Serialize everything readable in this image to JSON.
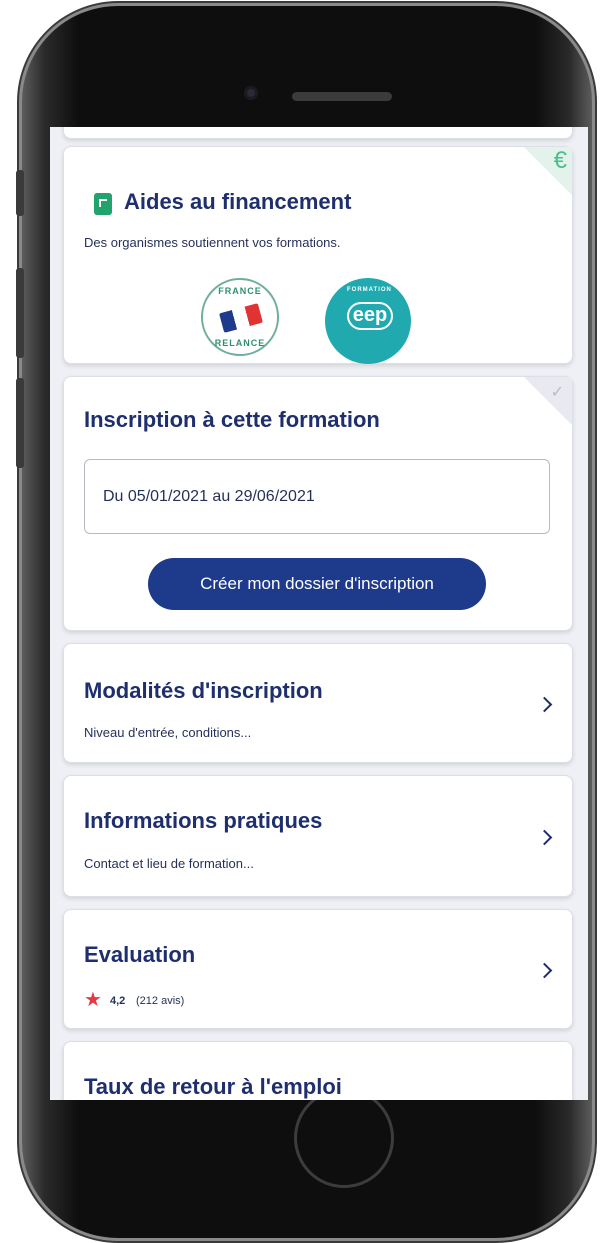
{
  "financing": {
    "title": "Aides au financement",
    "subtitle": "Des organismes soutiennent vos formations.",
    "logos": [
      {
        "name": "france-relance-logo",
        "text_top": "FRANCE",
        "text_bottom": "RELANCE"
      },
      {
        "name": "eep-logo",
        "text": "eep",
        "ring_text": "FORMATION"
      }
    ],
    "corner_icon": "euro-icon"
  },
  "registration": {
    "title": "Inscription à cette formation",
    "date_range": "Du 05/01/2021 au 29/06/2021",
    "cta_label": "Créer mon dossier d'inscription",
    "corner_icon": "person-check-icon"
  },
  "sections": [
    {
      "title": "Modalités d'inscription",
      "subtitle": "Niveau d'entrée, conditions..."
    },
    {
      "title": "Informations pratiques",
      "subtitle": "Contact et lieu de formation..."
    },
    {
      "title": "Evaluation",
      "rating": "4,2",
      "reviews": "(212 avis)"
    },
    {
      "title": "Taux de retour à l'emploi"
    }
  ],
  "colors": {
    "primary": "#1e3a8a",
    "title": "#1f2f6e",
    "accent_green": "#21a36d",
    "star": "#e23b45"
  }
}
